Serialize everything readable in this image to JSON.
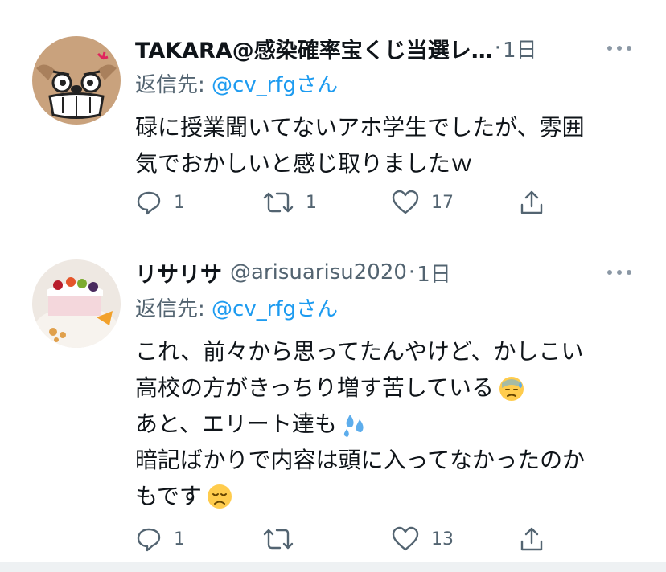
{
  "tweets": [
    {
      "name": "TAKARA@感染確率宝くじ当選レ…",
      "handle": "",
      "time": "1日",
      "dot": "·",
      "reply_prefix": "返信先: ",
      "reply_to": "@cv_rfg",
      "reply_suffix": "さん",
      "body_lines": [
        "碌に授業聞いてないアホ学生でしたが、雰囲",
        "気でおかしいと感じ取りましたｗ"
      ],
      "actions": {
        "reply": "1",
        "retweet": "1",
        "like": "17"
      }
    },
    {
      "name": "リサリサ",
      "handle": "@arisuarisu2020",
      "time": "1日",
      "dot": "·",
      "reply_prefix": "返信先: ",
      "reply_to": "@cv_rfg",
      "reply_suffix": "さん",
      "body_lines": [
        "これ、前々から思ってたんやけど、かしこい",
        "高校の方がきっちり増す苦している",
        "あと、エリート達も",
        "暗記ばかりで内容は頭に入ってなかったのか",
        "もです"
      ],
      "emojis": [
        "sweat-face-emoji",
        "sweat-droplets-emoji",
        "disappointed-face-emoji"
      ],
      "actions": {
        "reply": "1",
        "retweet": "",
        "like": "13"
      }
    }
  ],
  "colors": {
    "accent": "#1d9bf0",
    "secondary_text": "#536471",
    "divider": "#e6ecf0"
  }
}
